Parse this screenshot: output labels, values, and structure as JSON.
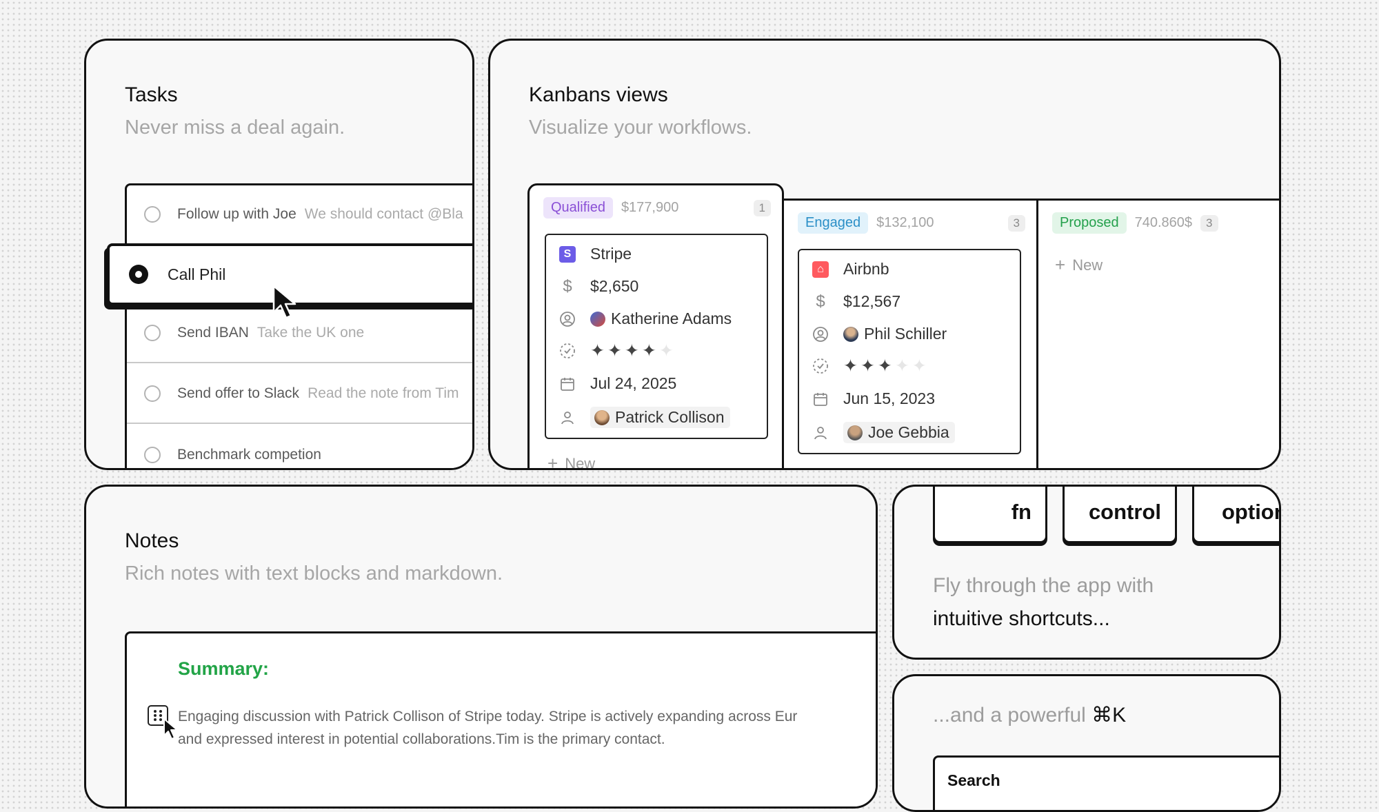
{
  "tasks": {
    "title": "Tasks",
    "subtitle": "Never miss a deal again.",
    "items": [
      {
        "title": "Follow up with Joe",
        "note": "We should contact @Bla"
      },
      {
        "title": "Call Phil",
        "note": ""
      },
      {
        "title": "Send IBAN",
        "note": "Take the UK one"
      },
      {
        "title": "Send offer to Slack",
        "note": "Read the note from Tim"
      },
      {
        "title": "Benchmark competion",
        "note": ""
      }
    ]
  },
  "kanban": {
    "title": "Kanbans views",
    "subtitle": "Visualize your workflows.",
    "columns": [
      {
        "label": "Qualified",
        "amount": "$177,900",
        "count": "1",
        "color_bg": "#ede4fb",
        "color_fg": "#8a4fd6",
        "card": {
          "company": "Stripe",
          "value": "$2,650",
          "owner": "Katherine Adams",
          "stars": 4,
          "date": "Jul 24, 2025",
          "contact": "Patrick Collison"
        },
        "new_label": "New"
      },
      {
        "label": "Engaged",
        "amount": "$132,100",
        "count": "3",
        "color_bg": "#e1f2fb",
        "color_fg": "#2b8fc7",
        "card": {
          "company": "Airbnb",
          "value": "$12,567",
          "owner": "Phil Schiller",
          "stars": 3,
          "date": "Jun 15, 2023",
          "contact": "Joe Gebbia"
        }
      },
      {
        "label": "Proposed",
        "amount": "740.860$",
        "count": "3",
        "color_bg": "#e2f5e8",
        "color_fg": "#23a04b",
        "new_label": "New"
      }
    ]
  },
  "notes": {
    "title": "Notes",
    "subtitle": "Rich notes with text blocks and markdown.",
    "heading": "Summary:",
    "line1": "Engaging discussion with Patrick Collison of Stripe today. Stripe is actively expanding across Eur",
    "line2": "and expressed interest in potential collaborations.Tim is the primary contact."
  },
  "shortcuts": {
    "keys": [
      "fn",
      "control",
      "option"
    ],
    "line1": "Fly through the app with",
    "line2": "intuitive shortcuts..."
  },
  "command": {
    "text": "...and a powerful",
    "shortcut": "⌘K",
    "search_label": "Search"
  }
}
